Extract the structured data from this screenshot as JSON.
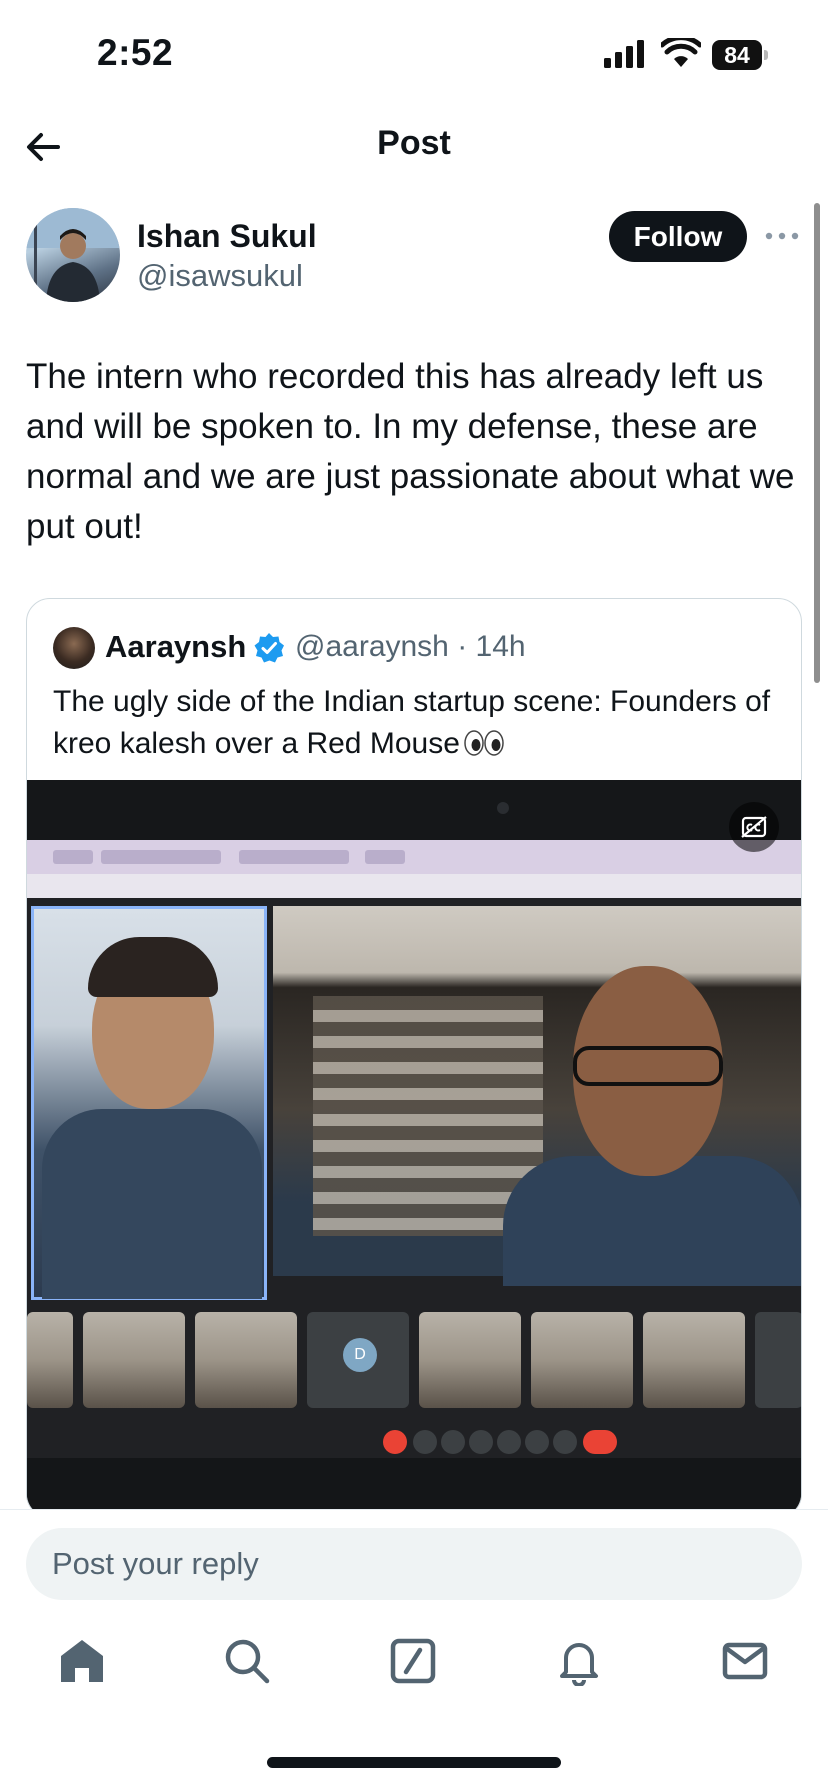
{
  "status_bar": {
    "time": "2:52",
    "battery_level": "84"
  },
  "header": {
    "title": "Post"
  },
  "post": {
    "author_name": "Ishan Sukul",
    "author_handle": "@isawsukul",
    "follow_label": "Follow",
    "text": "The intern who recorded this has already left us and will be spoken to. In my defense, these are normal and we are just passionate about what we put out!"
  },
  "quoted_post": {
    "author_name": "Aaraynsh",
    "verified": true,
    "meta": "@aaraynsh · 14h",
    "text": "The ugly side of the Indian startup scene: Founders of kreo kalesh over a Red Mouse",
    "emoji_icon": "eyes-emoji"
  },
  "reply": {
    "placeholder": "Post your reply"
  },
  "tab_bar": {
    "items": [
      "home-icon",
      "search-icon",
      "grok-icon",
      "notifications-icon",
      "messages-icon"
    ]
  },
  "colors": {
    "text_primary": "#0f1419",
    "text_secondary": "#536471",
    "verified_blue": "#1d9bf0",
    "reply_bg": "#eff3f4"
  }
}
